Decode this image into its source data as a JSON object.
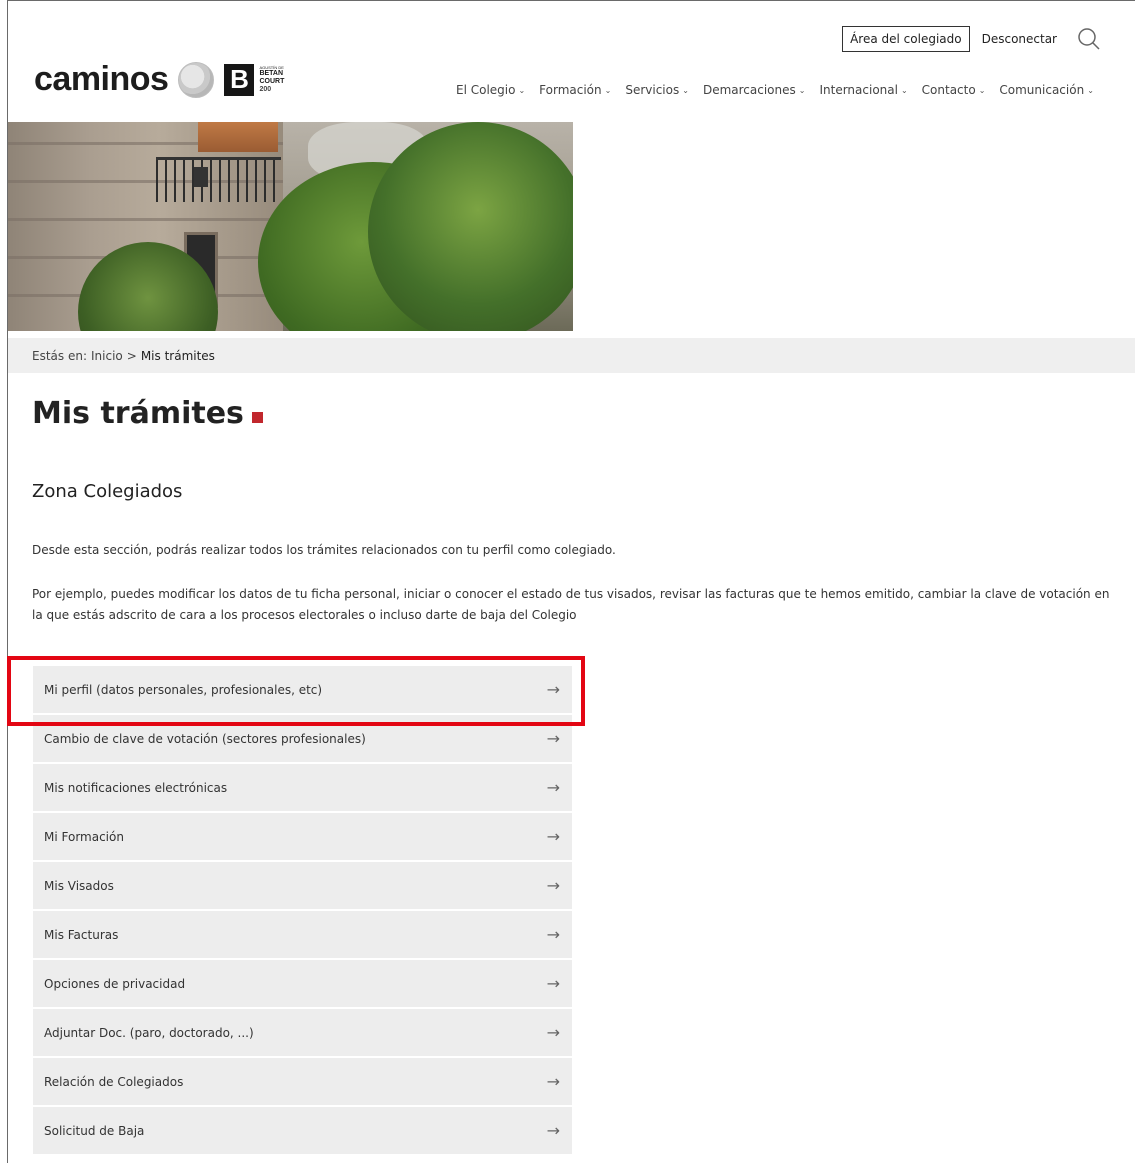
{
  "header": {
    "logo_text": "caminos",
    "logo_mark": {
      "letter": "B",
      "line1": "AGUSTÍN DE",
      "line2": "BETAN",
      "line3": "COURT",
      "line4": "200"
    },
    "area_button": "Área del colegiado",
    "logout": "Desconectar",
    "search_icon": "search-icon"
  },
  "nav": {
    "items": [
      {
        "label": "El Colegio"
      },
      {
        "label": "Formación"
      },
      {
        "label": "Servicios"
      },
      {
        "label": "Demarcaciones"
      },
      {
        "label": "Internacional"
      },
      {
        "label": "Contacto"
      },
      {
        "label": "Comunicación"
      }
    ],
    "chevron": "⌄"
  },
  "breadcrumb": {
    "prefix": "Estás en:",
    "home": "Inicio",
    "separator": ">",
    "current": "Mis trámites"
  },
  "page": {
    "title": "Mis trámites",
    "accent_color": "#c1272d",
    "subtitle": "Zona Colegiados",
    "intro": "Desde esta sección, podrás realizar todos los trámites relacionados con tu perfil como colegiado.",
    "example": "Por ejemplo, puedes modificar los datos de tu ficha personal, iniciar o conocer el estado de tus visados, revisar las facturas que te hemos emitido, cambiar la clave de votación en la que estás adscrito de cara a los procesos electorales o incluso darte de baja del Colegio"
  },
  "tramites": {
    "arrow": "→",
    "items": [
      {
        "label": "Mi perfil (datos personales, profesionales, etc)"
      },
      {
        "label": "Cambio de clave de votación (sectores profesionales)"
      },
      {
        "label": "Mis notificaciones electrónicas"
      },
      {
        "label": "Mi Formación"
      },
      {
        "label": "Mis Visados"
      },
      {
        "label": "Mis Facturas"
      },
      {
        "label": "Opciones de privacidad"
      },
      {
        "label": "Adjuntar Doc. (paro, doctorado, ...)"
      },
      {
        "label": "Relación de Colegiados"
      },
      {
        "label": "Solicitud de Baja"
      }
    ]
  },
  "highlight_color": "#e30613"
}
